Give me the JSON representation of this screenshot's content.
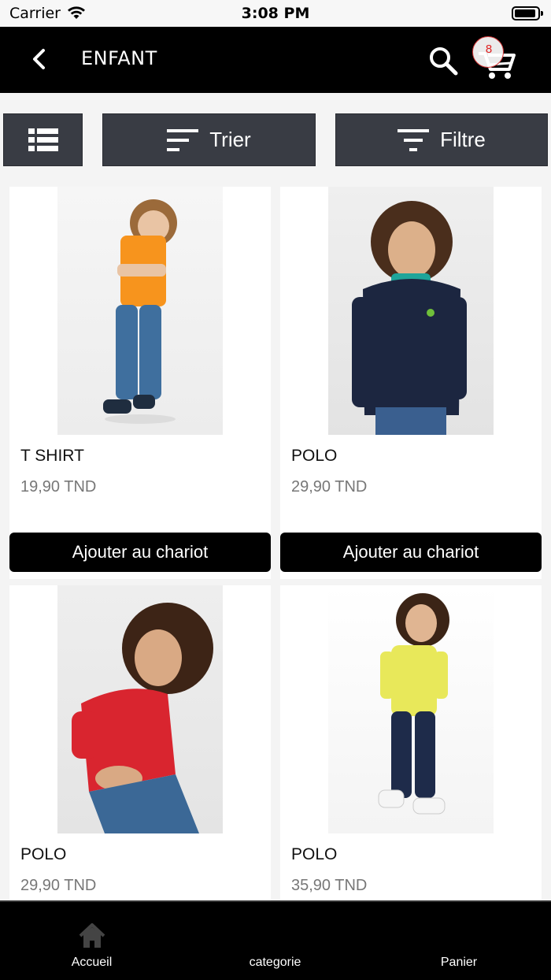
{
  "status_bar": {
    "carrier": "Carrier",
    "time": "3:08 PM"
  },
  "header": {
    "title": "ENFANT",
    "cart_count": "8"
  },
  "toolbar": {
    "sort_label": "Trier",
    "filter_label": "Filtre"
  },
  "products": [
    {
      "name": "T SHIRT",
      "price": "19,90 TND",
      "add_label": "Ajouter au chariot",
      "shirt_color": "#f7941d",
      "pants_color": "#3f6f9e"
    },
    {
      "name": "POLO",
      "price": "29,90 TND",
      "add_label": "Ajouter au chariot",
      "shirt_color": "#1c2640",
      "pants_color": "#3a5f8f"
    },
    {
      "name": "POLO",
      "price": "29,90 TND",
      "add_label": "",
      "shirt_color": "#d9252f",
      "pants_color": "#3b6896"
    },
    {
      "name": "POLO",
      "price": "35,90 TND",
      "add_label": "",
      "shirt_color": "#e8e85a",
      "pants_color": "#1e2b4a"
    }
  ],
  "bottom_nav": [
    {
      "label": "Accueil",
      "icon": "home-icon"
    },
    {
      "label": "categorie",
      "icon": ""
    },
    {
      "label": "Panier",
      "icon": ""
    }
  ]
}
